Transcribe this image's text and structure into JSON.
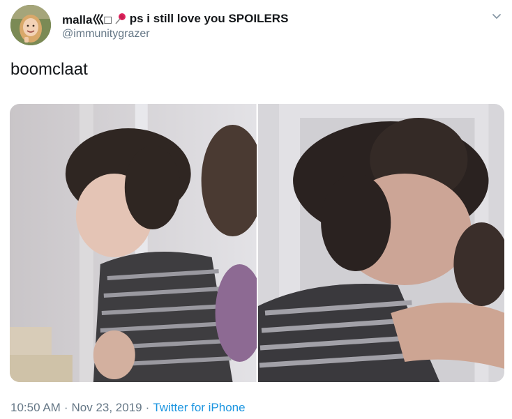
{
  "user": {
    "display_name": "malla⼮□",
    "display_name_suffix": "ps i still love you SPOILERS",
    "handle": "@immunitygrazer",
    "avatar_icon": "profile-photo"
  },
  "tweet": {
    "text": "boomclaat"
  },
  "media": {
    "photos": [
      {
        "name": "photo-1"
      },
      {
        "name": "photo-2"
      }
    ]
  },
  "meta": {
    "time": "10:50 AM",
    "separator1": "·",
    "date": "Nov 23, 2019",
    "separator2": "·",
    "source": "Twitter for iPhone"
  },
  "colors": {
    "text": "#14171a",
    "secondary": "#657786",
    "link": "#1b95e0"
  },
  "icons": {
    "pin": "pushpin-icon",
    "menu": "chevron-down-icon"
  }
}
